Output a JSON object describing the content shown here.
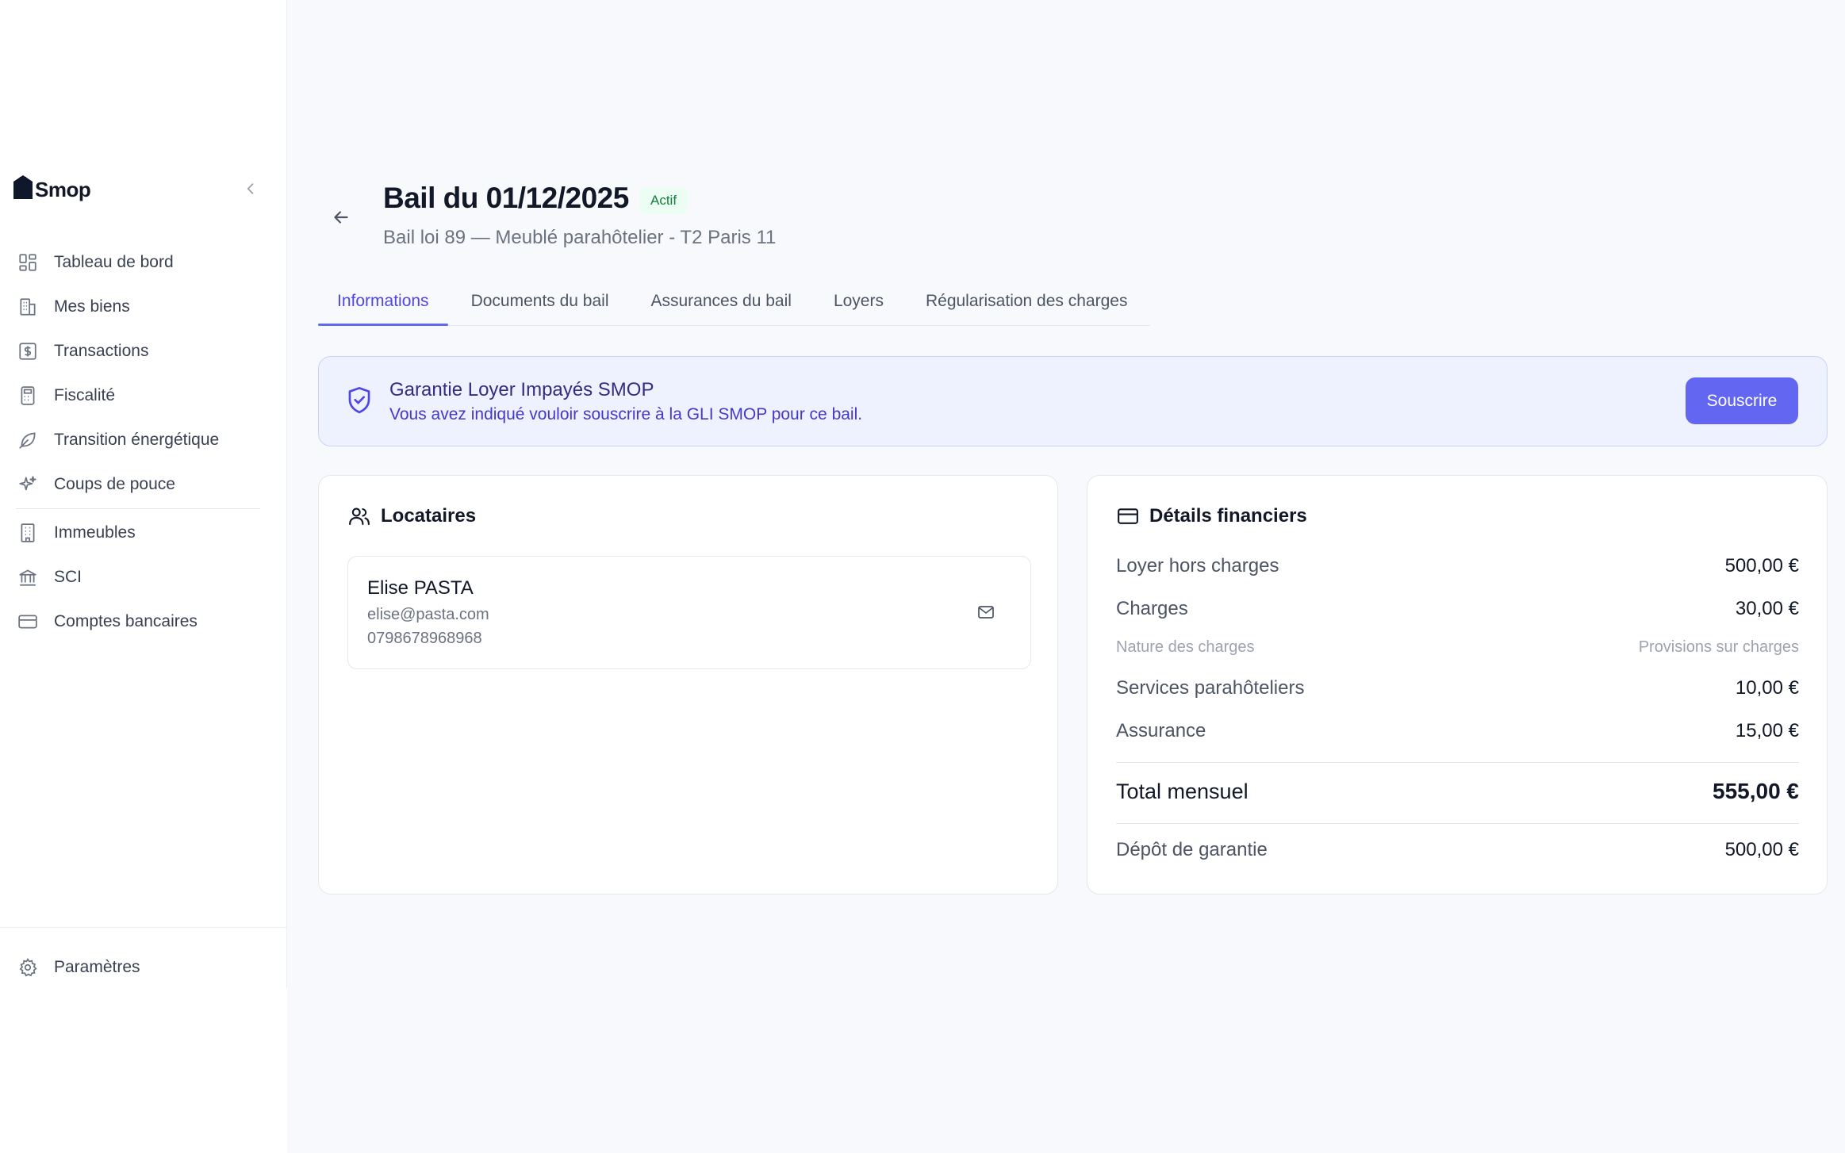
{
  "app": {
    "logo_text": "Smop"
  },
  "sidebar": {
    "items": [
      {
        "label": "Tableau de bord",
        "icon": "dashboard-icon"
      },
      {
        "label": "Mes biens",
        "icon": "buildings-icon"
      },
      {
        "label": "Transactions",
        "icon": "dollar-icon"
      },
      {
        "label": "Fiscalité",
        "icon": "calculator-icon"
      },
      {
        "label": "Transition énergétique",
        "icon": "leaf-icon"
      },
      {
        "label": "Coups de pouce",
        "icon": "sparkles-icon"
      }
    ],
    "items2": [
      {
        "label": "Immeubles",
        "icon": "building-icon"
      },
      {
        "label": "SCI",
        "icon": "bank-icon"
      },
      {
        "label": "Comptes bancaires",
        "icon": "credit-card-icon"
      }
    ],
    "settings": {
      "label": "Paramètres",
      "icon": "gear-icon"
    }
  },
  "header": {
    "title": "Bail du 01/12/2025",
    "status": "Actif",
    "subtitle": "Bail loi 89 — Meublé parahôtelier - T2 Paris 11"
  },
  "tabs": [
    {
      "label": "Informations",
      "active": true
    },
    {
      "label": "Documents du bail",
      "active": false
    },
    {
      "label": "Assurances du bail",
      "active": false
    },
    {
      "label": "Loyers",
      "active": false
    },
    {
      "label": "Régularisation des charges",
      "active": false
    }
  ],
  "banner": {
    "title": "Garantie Loyer Impayés SMOP",
    "text": "Vous avez indiqué vouloir souscrire à la GLI SMOP pour ce bail.",
    "button": "Souscrire"
  },
  "tenants": {
    "title": "Locataires",
    "items": [
      {
        "name": "Elise PASTA",
        "email": "elise@pasta.com",
        "phone": "0798678968968"
      }
    ]
  },
  "financial": {
    "title": "Détails financiers",
    "rows": [
      {
        "label": "Loyer hors charges",
        "value": "500,00 €"
      },
      {
        "label": "Charges",
        "value": "30,00 €"
      },
      {
        "label": "Nature des charges",
        "value": "Provisions sur charges"
      },
      {
        "label": "Services parahôteliers",
        "value": "10,00 €"
      },
      {
        "label": "Assurance",
        "value": "15,00 €"
      }
    ],
    "total": {
      "label": "Total mensuel",
      "value": "555,00 €"
    },
    "deposit": {
      "label": "Dépôt de garantie",
      "value": "500,00 €"
    }
  },
  "colors": {
    "accent": "#6366f1",
    "accent_dark": "#4f46e5",
    "success_bg": "#ecfdf3",
    "success_text": "#15803d",
    "banner_bg": "#eef2ff"
  }
}
